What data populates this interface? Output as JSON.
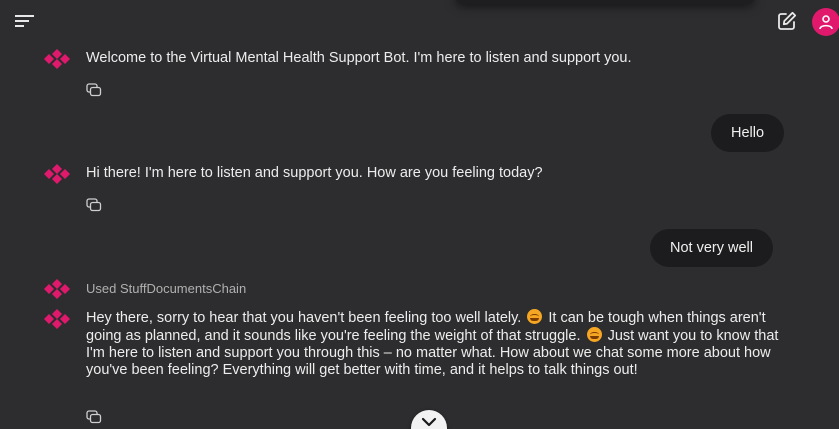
{
  "header": {
    "menu_icon": "hamburger-menu-icon",
    "new_chat_icon": "edit-square-icon",
    "avatar_icon": "user-icon",
    "accent_color": "#e0196d"
  },
  "messages": [
    {
      "role": "bot",
      "text": "Welcome to the Virtual Mental Health Support Bot. I'm here to listen and support you."
    },
    {
      "role": "user",
      "text": "Hello"
    },
    {
      "role": "bot",
      "text": "Hi there! I'm here to listen and support you. How are you feeling today?"
    },
    {
      "role": "user",
      "text": "Not very well"
    },
    {
      "role": "bot-meta",
      "text": "Used StuffDocumentsChain"
    },
    {
      "role": "bot",
      "parts": [
        "Hey there, sorry to hear that you haven't been feeling too well lately.",
        "It can be tough when things aren't going as planned, and it sounds like you're feeling the weight of that struggle.",
        "Just want you to know that I'm here to listen and support you through this – no matter what. How about we chat some more about how you've been feeling? Everything will get better with time, and it helps to talk things out!"
      ]
    }
  ],
  "copy_icon": "copy-icon",
  "scroll_down_icon": "chevron-down-icon"
}
